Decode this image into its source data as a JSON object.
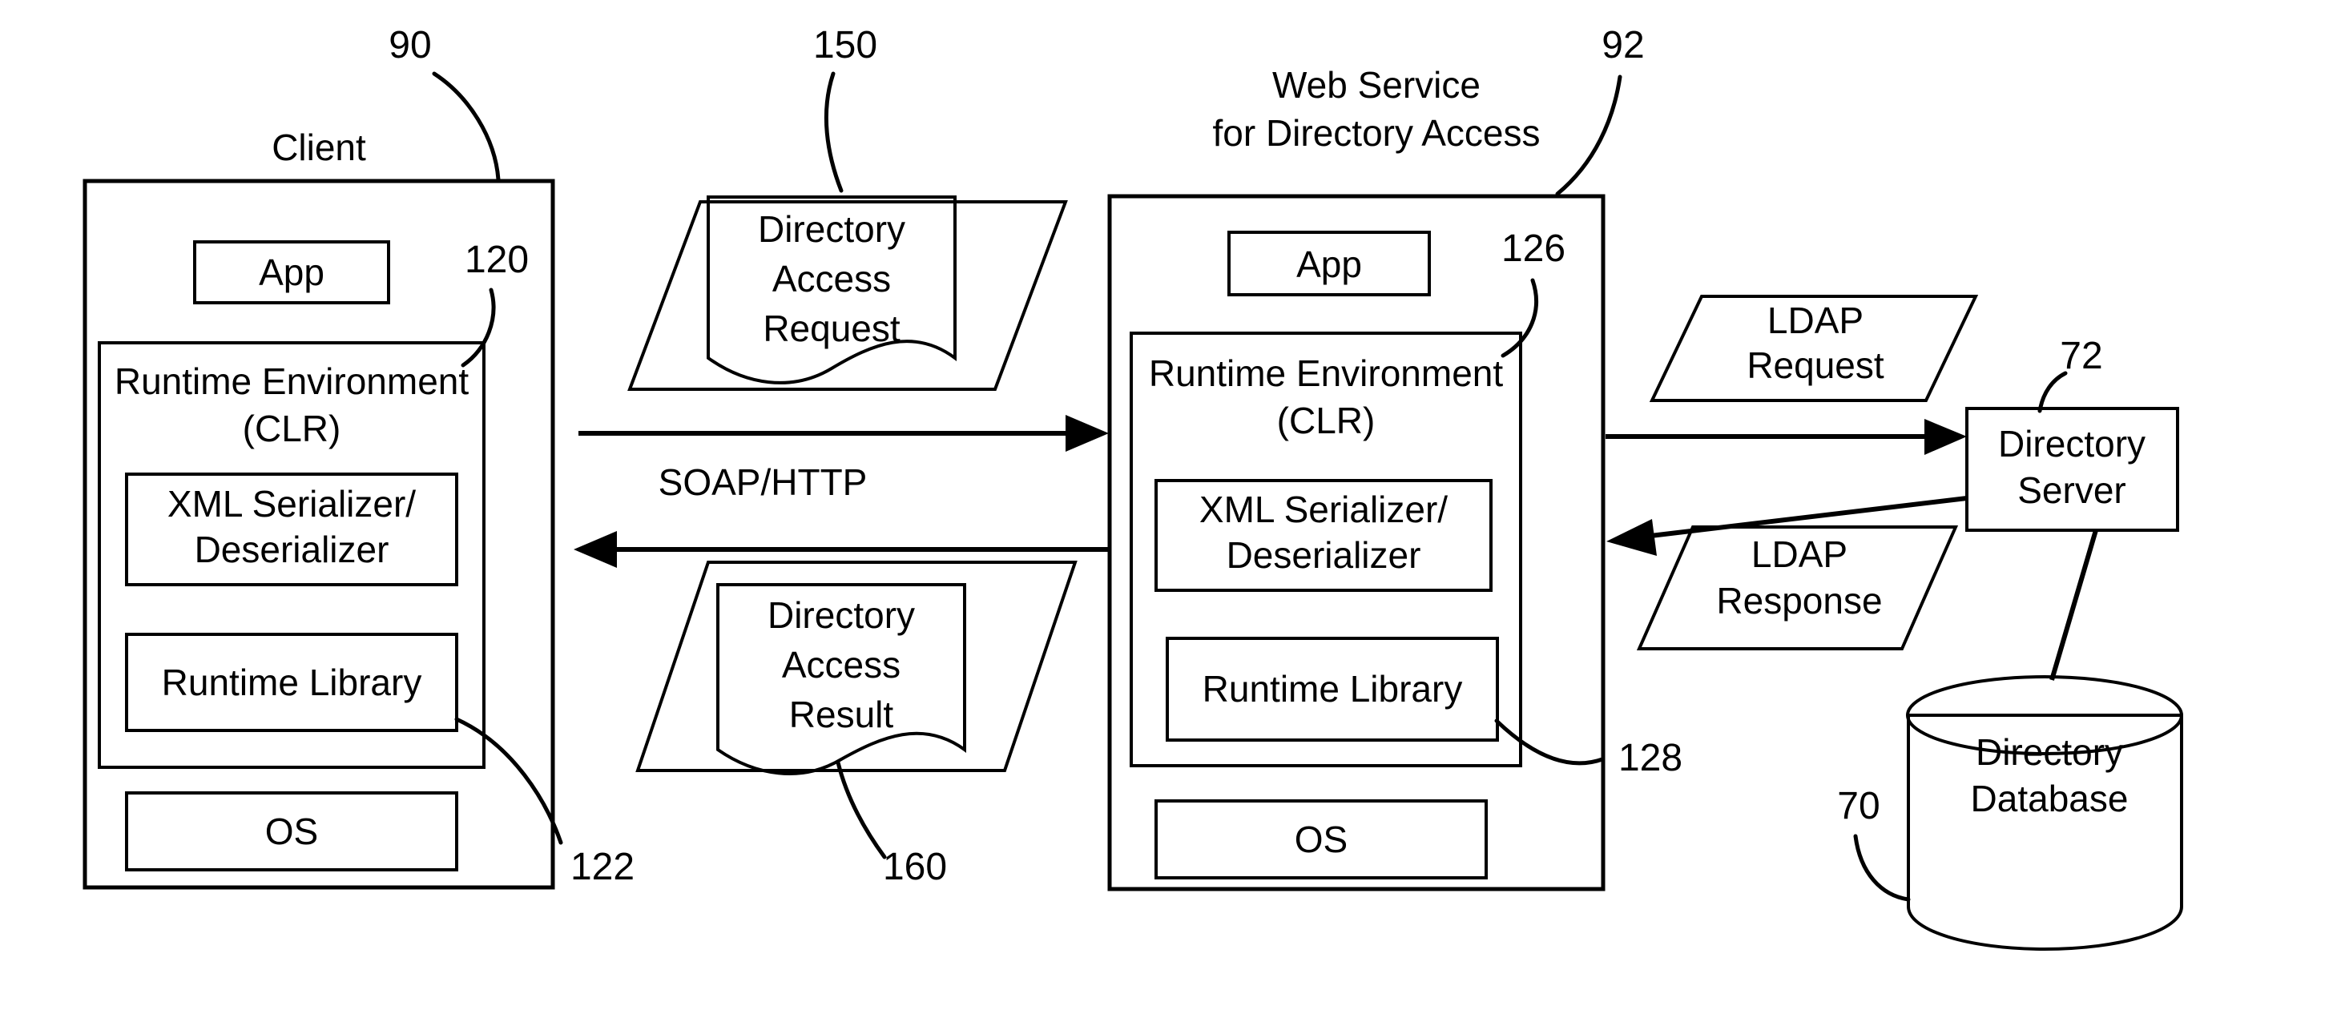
{
  "figure": {
    "title_client": "Client",
    "title_web_service_line1": "Web Service",
    "title_web_service_line2": "for Directory Access",
    "protocol_label": "SOAP/HTTP"
  },
  "client": {
    "app": "App",
    "runtime_env_line1": "Runtime Environment",
    "runtime_env_line2": "(CLR)",
    "serializer_line1": "XML Serializer/",
    "serializer_line2": "Deserializer",
    "runtime_library": "Runtime Library",
    "os": "OS"
  },
  "web_service": {
    "app": "App",
    "runtime_env_line1": "Runtime Environment",
    "runtime_env_line2": "(CLR)",
    "serializer_line1": "XML Serializer/",
    "serializer_line2": "Deserializer",
    "runtime_library": "Runtime Library",
    "os": "OS"
  },
  "messages": {
    "dir_access_request_line1": "Directory",
    "dir_access_request_line2": "Access",
    "dir_access_request_line3": "Request",
    "dir_access_result_line1": "Directory",
    "dir_access_result_line2": "Access",
    "dir_access_result_line3": "Result",
    "ldap_request_line1": "LDAP",
    "ldap_request_line2": "Request",
    "ldap_response_line1": "LDAP",
    "ldap_response_line2": "Response"
  },
  "server": {
    "directory_server_line1": "Directory",
    "directory_server_line2": "Server",
    "directory_database_line1": "Directory",
    "directory_database_line2": "Database"
  },
  "reference_numerals": {
    "client": "90",
    "client_runtime": "120",
    "client_runtime_library": "122",
    "dir_access_request": "150",
    "dir_access_result": "160",
    "web_service": "92",
    "web_service_runtime": "126",
    "web_service_runtime_library": "128",
    "directory_server": "72",
    "directory_database": "70"
  },
  "colors": {
    "stroke": "#000000",
    "background": "#ffffff"
  }
}
